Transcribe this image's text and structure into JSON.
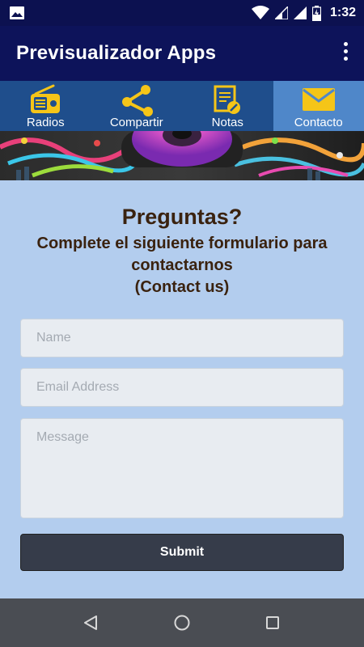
{
  "status_bar": {
    "time": "1:32",
    "icons": [
      "image-icon",
      "wifi-icon",
      "signal-icon",
      "signal-icon",
      "battery-charging-icon"
    ]
  },
  "app_bar": {
    "title": "Previsualizador Apps",
    "menu_icon": "overflow-menu-icon"
  },
  "tabs": [
    {
      "label": "Radios",
      "icon": "radio-icon",
      "active": false
    },
    {
      "label": "Compartir",
      "icon": "share-icon",
      "active": false
    },
    {
      "label": "Notas",
      "icon": "notes-icon",
      "active": false
    },
    {
      "label": "Contacto",
      "icon": "mail-icon",
      "active": true
    }
  ],
  "form": {
    "heading": "Preguntas?",
    "subheading_line1": "Complete el siguiente formulario para",
    "subheading_line2": "contactarnos",
    "subheading_line3": "(Contact us)",
    "name_placeholder": "Name",
    "email_placeholder": "Email Address",
    "message_placeholder": "Message",
    "submit_label": "Submit"
  },
  "nav_bar": {
    "icons": [
      "back-icon",
      "home-icon",
      "recents-icon"
    ]
  },
  "colors": {
    "app_bar": "#0d135a",
    "tab_bar": "#1f4e8c",
    "tab_active": "#4f87c9",
    "icon_yellow": "#f5c518",
    "content_bg": "#b3cdee",
    "submit_bg": "#363c4a"
  }
}
